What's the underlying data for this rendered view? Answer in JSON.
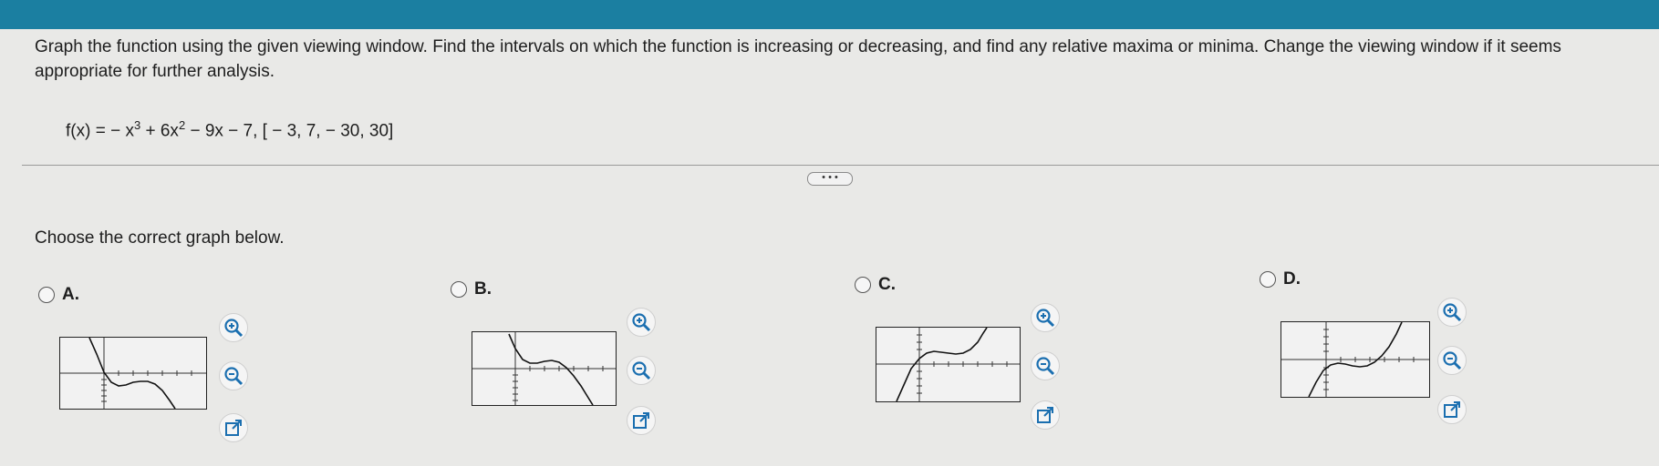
{
  "question": {
    "text": "Graph the function using the given viewing window. Find the intervals on which the function is increasing or decreasing, and find any relative maxima or minima. Change the viewing window if it seems appropriate for further analysis.",
    "formula": {
      "lhs": "f(x) = − x",
      "exp1": "3",
      "mid": " + 6x",
      "exp2": "2",
      "rhs": " − 9x − 7, [ − 3, 7, − 30, 30]"
    }
  },
  "more_button": "• • •",
  "prompt": "Choose the correct graph below.",
  "choices": [
    {
      "label": "A."
    },
    {
      "label": "B."
    },
    {
      "label": "C."
    },
    {
      "label": "D."
    }
  ],
  "colors": {
    "topbar": "#1b7fa1",
    "tool_accent": "#1b6fb0"
  },
  "icons": {
    "zoom_in": "zoom-in-icon",
    "zoom_out": "zoom-out-icon",
    "expand": "external-window-icon"
  }
}
